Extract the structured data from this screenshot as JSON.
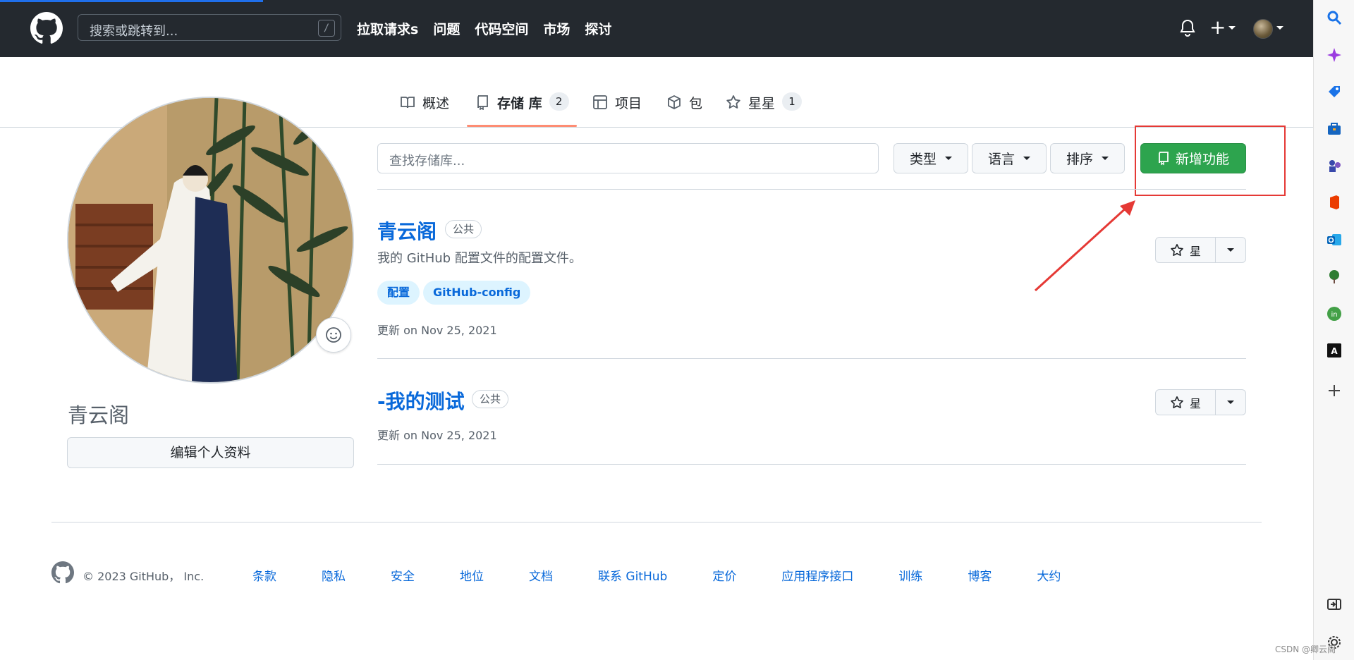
{
  "header": {
    "search_placeholder": "搜索或跳转到...",
    "search_shortcut": "/",
    "nav": [
      "拉取请求s",
      "问题",
      "代码空间",
      "市场",
      "探讨"
    ]
  },
  "tabs": [
    {
      "label": "概述",
      "icon": "book-icon"
    },
    {
      "label": "存储 库",
      "icon": "repo-icon",
      "count": "2",
      "active": true
    },
    {
      "label": "项目",
      "icon": "table-icon"
    },
    {
      "label": "包",
      "icon": "package-icon"
    },
    {
      "label": "星星",
      "icon": "star-icon",
      "count": "1"
    }
  ],
  "profile": {
    "name": "青云阁",
    "edit_label": "编辑个人资料"
  },
  "filters": {
    "find_placeholder": "查找存储库...",
    "type_label": "类型",
    "language_label": "语言",
    "sort_label": "排序",
    "new_label": "新增功能"
  },
  "repos": [
    {
      "name": "青云阁",
      "visibility": "公共",
      "description": "我的 GitHub 配置文件的配置文件。",
      "topics": [
        "配置",
        "GitHub-config"
      ],
      "updated": "更新 on Nov 25, 2021",
      "star_label": "星"
    },
    {
      "name": "-我的测试",
      "visibility": "公共",
      "updated": "更新 on Nov 25, 2021",
      "star_label": "星"
    }
  ],
  "footer": {
    "copyright": "© 2023 GitHub， Inc.",
    "links": [
      "条款",
      "隐私",
      "安全",
      "地位",
      "文档",
      "联系 GitHub",
      "定价",
      "应用程序接口",
      "训练",
      "博客",
      "大约"
    ]
  },
  "watermark": "CSDN @卿云阁",
  "colors": {
    "header_bg": "#24292f",
    "primary_green": "#2da44e",
    "link_blue": "#0969da",
    "annotation_red": "#e53935",
    "tab_underline": "#fd8c73"
  }
}
